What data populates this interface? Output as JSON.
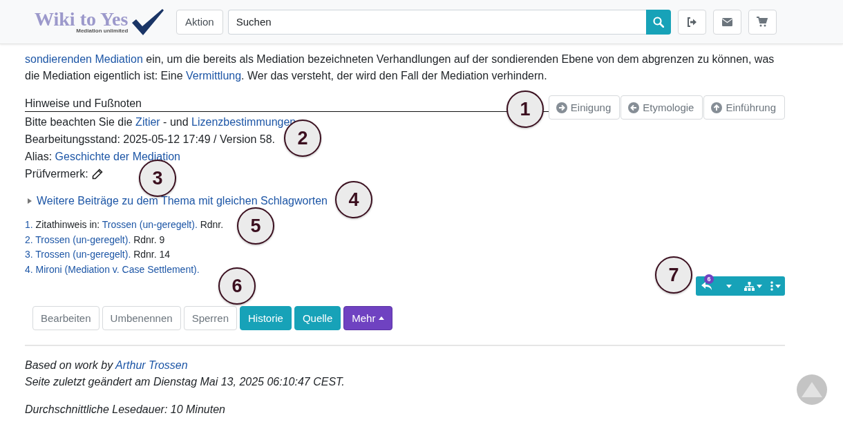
{
  "header": {
    "logo_title": "Wiki to Yes",
    "logo_subtitle": "Mediation unlimited",
    "action_button": "Aktion",
    "search": {
      "placeholder": "Suchen"
    },
    "icon_buttons": [
      {
        "kind": "logout"
      },
      {
        "kind": "mail"
      },
      {
        "kind": "cart"
      }
    ]
  },
  "article": {
    "paragraph": [
      {
        "kind": "link",
        "text": "sondierenden Mediation"
      },
      {
        "kind": "text",
        "text": " ein, um die bereits als Mediation bezeichneten Verhandlungen auf der sondierenden Ebene von dem abgrenzen zu können, was die Mediation eigentlich ist: Eine "
      },
      {
        "kind": "link",
        "text": "Vermittlung"
      },
      {
        "kind": "text",
        "text": ". Wer das versteht, der wird den Fall der Mediation verhindern."
      }
    ]
  },
  "notes": {
    "heading": "Hinweise und Fußnoten",
    "nav_buttons": [
      {
        "label": "Einigung",
        "kind": "right"
      },
      {
        "label": "Etymologie",
        "kind": "left"
      },
      {
        "label": "Einführung",
        "kind": "up"
      }
    ],
    "lines": [
      [
        {
          "kind": "text",
          "text": "Bitte beachten Sie die "
        },
        {
          "kind": "link",
          "text": "Zitier"
        },
        {
          "kind": "text",
          "text": " - und "
        },
        {
          "kind": "link",
          "text": "Lizenzbestimmungen"
        }
      ],
      [
        {
          "kind": "text",
          "text": "Bearbeitungsstand: 2025-05-12 17:49 / Version 58."
        }
      ],
      [
        {
          "kind": "text",
          "text": "Alias: "
        },
        {
          "kind": "link",
          "text": "Geschichte der Mediation"
        }
      ]
    ],
    "review_label": "Prüfvermerk:",
    "more_topics": {
      "label": "Weitere Beiträge zu dem Thema mit gleichen Schlagworten",
      "expanded": false
    },
    "footnotes": [
      [
        {
          "kind": "link",
          "text": "1."
        },
        {
          "kind": "text",
          "text": " Zitathinweis in: "
        },
        {
          "kind": "link",
          "text": "Trossen (un-geregelt)."
        },
        {
          "kind": "text",
          "text": " Rdnr."
        }
      ],
      [
        {
          "kind": "link",
          "text": "2. Trossen (un-geregelt)."
        },
        {
          "kind": "text",
          "text": " Rdnr. 9"
        }
      ],
      [
        {
          "kind": "link",
          "text": "3. Trossen (un-geregelt)."
        },
        {
          "kind": "text",
          "text": " Rdnr. 14"
        }
      ],
      [
        {
          "kind": "link",
          "text": "4. Mironi (Mediation v. Case Settlement)."
        }
      ]
    ]
  },
  "toolbar": {
    "badge": "6"
  },
  "actions": [
    {
      "label": "Bearbeiten",
      "kind": "outline"
    },
    {
      "label": "Umbenennen",
      "kind": "outline"
    },
    {
      "label": "Sperren",
      "kind": "outline"
    },
    {
      "label": "Historie",
      "kind": "info"
    },
    {
      "label": "Quelle",
      "kind": "info"
    },
    {
      "label": "Mehr",
      "kind": "more"
    }
  ],
  "footer": {
    "based_on": [
      {
        "kind": "text",
        "text": "Based on work by "
      },
      {
        "kind": "link",
        "text": "Arthur Trossen"
      }
    ],
    "modified": "Seite zuletzt geändert am Dienstag Mai 13, 2025 06:10:47 CEST.",
    "reading_time": "Durchschnittliche Lesedauer: 10 Minuten"
  },
  "callouts": [
    "1",
    "2",
    "3",
    "4",
    "5",
    "6",
    "7"
  ]
}
